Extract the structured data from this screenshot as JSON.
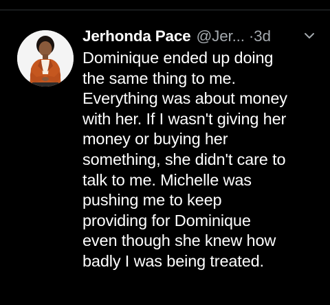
{
  "tweet": {
    "display_name": "Jerhonda Pace",
    "handle": "@Jer...",
    "separator": "·",
    "time": "3d",
    "text_lines": [
      "Dominique ended up doing",
      "the same thing to me.",
      "Everything was about money",
      "with her. If I wasn't giving her",
      "money or buying her",
      "something, she didn't care to",
      "talk to me. Michelle was",
      "pushing me to keep",
      "providing for Dominique",
      "even though she knew how",
      "badly I was being treated."
    ]
  },
  "icons": {
    "avatar": "profile-photo",
    "more": "chevron-down-icon"
  },
  "colors": {
    "background": "#000000",
    "text": "#ffffff",
    "secondary_text": "#a4a9ae",
    "divider": "#2f3336"
  }
}
